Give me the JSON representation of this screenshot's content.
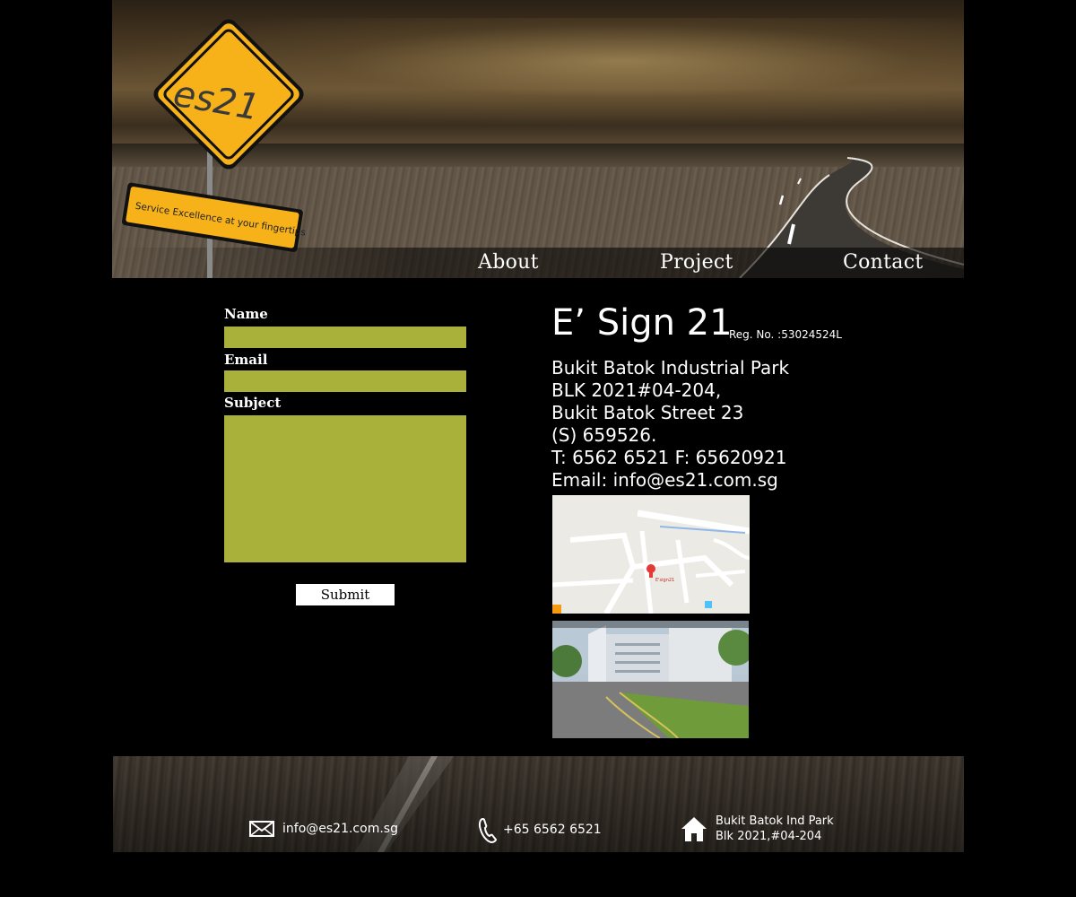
{
  "header": {
    "logo_text": "es21",
    "tagline": "Service Excellence at your fingertips",
    "nav": {
      "about": "About",
      "project": "Project",
      "contact": "Contact"
    }
  },
  "form": {
    "name_label": "Name",
    "email_label": "Email",
    "subject_label": "Subject",
    "name_value": "",
    "email_value": "",
    "subject_value": "",
    "submit_label": "Submit",
    "field_color": "#a9b13a"
  },
  "company": {
    "name": "E’ Sign 21",
    "reg_no": "Reg. No. :53024524L",
    "address": {
      "line1": "Bukit Batok Industrial Park",
      "line2": "BLK 2021#04-204,",
      "line3": "Bukit Batok Street 23",
      "line4": "(S) 659526.",
      "phone_fax": "T: 6562 6521 F: 65620921",
      "email": "Email: info@es21.com.sg"
    },
    "map_label": "E'sign21"
  },
  "footer": {
    "email": "info@es21.com.sg",
    "phone": "+65  6562 6521",
    "address_line1": "Bukit Batok Ind Park",
    "address_line2": "Blk 2021,#04-204",
    "icons": [
      "mail-icon",
      "phone-icon",
      "home-icon"
    ]
  },
  "colors": {
    "background": "#000000",
    "sign_yellow": "#f7b21a",
    "text": "#ffffff"
  }
}
